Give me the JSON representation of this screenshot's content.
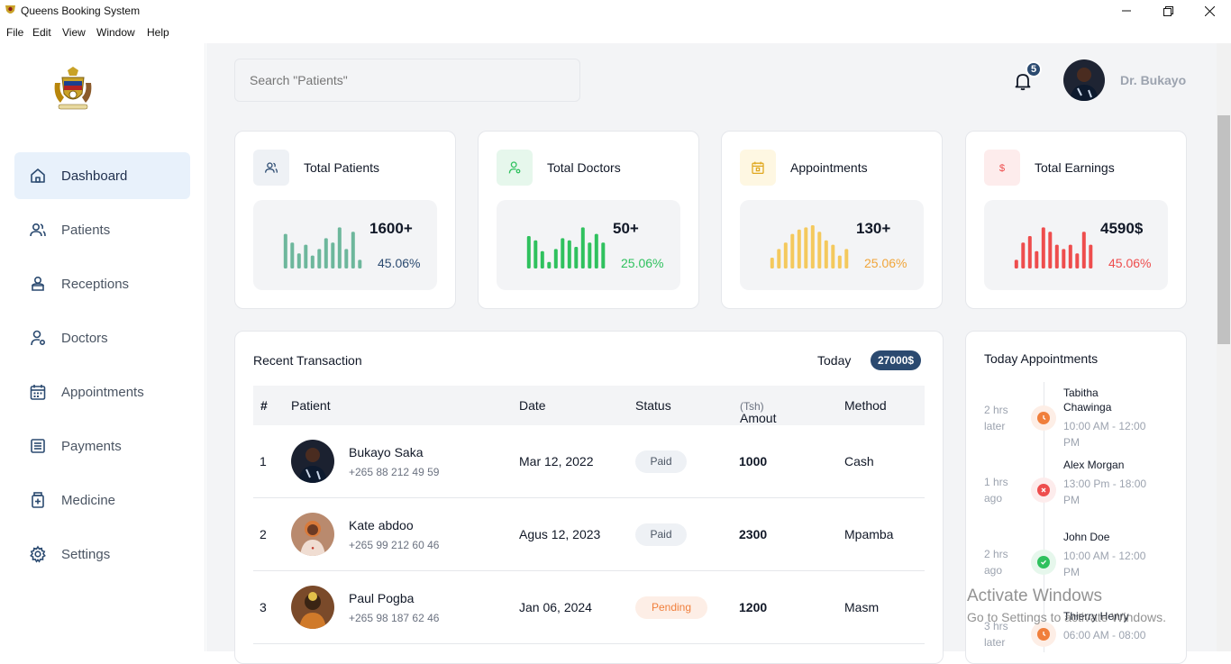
{
  "window": {
    "title": "Queens Booking System"
  },
  "menu": [
    "File",
    "Edit",
    "View",
    "Window",
    "Help"
  ],
  "sidebar": {
    "items": [
      {
        "label": "Dashboard",
        "icon": "home-icon",
        "active": true
      },
      {
        "label": "Patients",
        "icon": "users-icon"
      },
      {
        "label": "Receptions",
        "icon": "receptions-icon"
      },
      {
        "label": "Doctors",
        "icon": "doctor-icon"
      },
      {
        "label": "Appointments",
        "icon": "calendar-icon"
      },
      {
        "label": "Payments",
        "icon": "payments-icon"
      },
      {
        "label": "Medicine",
        "icon": "medicine-icon"
      },
      {
        "label": "Settings",
        "icon": "settings-icon"
      }
    ]
  },
  "header": {
    "search_placeholder": "Search \"Patients\"",
    "notification_count": "5",
    "user_name": "Dr. Bukayo"
  },
  "stats": [
    {
      "title": "Total Patients",
      "value": "1600+",
      "percent": "45.06%",
      "color": "#6db79c",
      "icon_bg": "#eef1f5",
      "icon": "users-icon",
      "bars": [
        0.8,
        0.6,
        0.35,
        0.55,
        0.3,
        0.45,
        0.7,
        0.6,
        0.95,
        0.45,
        0.85,
        0.2
      ]
    },
    {
      "title": "Total Doctors",
      "value": "50+",
      "percent": "25.06%",
      "color": "#2fc15e",
      "icon_bg": "#e6f7ec",
      "icon": "doctor-icon",
      "bars": [
        0.75,
        0.65,
        0.4,
        0.15,
        0.45,
        0.7,
        0.65,
        0.5,
        0.95,
        0.6,
        0.8,
        0.6
      ]
    },
    {
      "title": "Appointments",
      "value": "130+",
      "percent": "25.06%",
      "color": "#f4c95d",
      "icon_bg": "#fef7e2",
      "icon": "calendar-icon",
      "bars": [
        0.25,
        0.45,
        0.6,
        0.8,
        0.9,
        0.95,
        1.0,
        0.85,
        0.65,
        0.55,
        0.3,
        0.45
      ]
    },
    {
      "title": "Total Earnings",
      "value": "4590$",
      "percent": "45.06%",
      "color": "#ee4d4d",
      "icon_bg": "#fdecec",
      "icon": "dollar-icon",
      "bars": [
        0.2,
        0.6,
        0.75,
        0.4,
        0.95,
        0.85,
        0.55,
        0.45,
        0.55,
        0.35,
        0.85,
        0.55
      ]
    }
  ],
  "transactions": {
    "title": "Recent Transaction",
    "period_label": "Today",
    "total": "27000$",
    "columns": {
      "num": "#",
      "patient": "Patient",
      "date": "Date",
      "status": "Status",
      "amount": "Amout",
      "amount_unit": "(Tsh)",
      "method": "Method"
    },
    "rows": [
      {
        "num": "1",
        "name": "Bukayo Saka",
        "phone": "+265 88 212 49 59",
        "date": "Mar 12, 2022",
        "status": "Paid",
        "amount": "1000",
        "method": "Cash"
      },
      {
        "num": "2",
        "name": "Kate abdoo",
        "phone": "+265 99 212 60 46",
        "date": "Agus 12, 2023",
        "status": "Paid",
        "amount": "2300",
        "method": "Mpamba"
      },
      {
        "num": "3",
        "name": "Paul Pogba",
        "phone": "+265 98 187 62 46",
        "date": "Jan 06, 2024",
        "status": "Pending",
        "amount": "1200",
        "method": "Masm"
      }
    ]
  },
  "appointments": {
    "title": "Today Appointments",
    "items": [
      {
        "when": "2 hrs later",
        "name": "Tabitha Chawinga",
        "time": "10:00 AM - 12:00 PM",
        "status": "pending",
        "color": "#f07f3c"
      },
      {
        "when": "1 hrs ago",
        "name": "Alex Morgan",
        "time": "13:00 Pm - 18:00 PM",
        "status": "cancelled",
        "color": "#ee4d4d"
      },
      {
        "when": "2 hrs ago",
        "name": "John Doe",
        "time": "10:00 AM - 12:00 PM",
        "status": "done",
        "color": "#2fc15e"
      },
      {
        "when": "3 hrs later",
        "name": "Thierry Henry",
        "time": "06:00 AM - 08:00 AM",
        "status": "pending",
        "color": "#f07f3c"
      }
    ]
  },
  "watermark": {
    "line1": "Activate Windows",
    "line2": "Go to Settings to activate Windows."
  }
}
